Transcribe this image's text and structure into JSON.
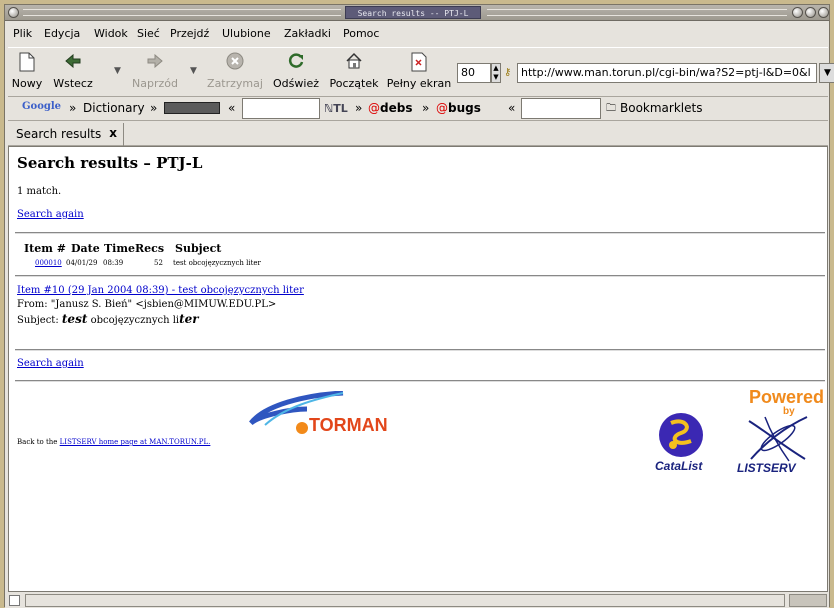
{
  "window": {
    "title": "Search results -- PTJ-L"
  },
  "menu": [
    "Plik",
    "Edycja",
    "Widok",
    "Sieć",
    "Przejdź",
    "Ulubione",
    "Zakładki",
    "Pomoc"
  ],
  "toolbar": {
    "new_label": "Nowy",
    "back_label": "Wstecz",
    "forward_label": "Naprzód",
    "stop_label": "Zatrzymaj",
    "reload_label": "Odśwież",
    "home_label": "Początek",
    "fullscreen_label": "Pełny ekran",
    "zoom_value": "80",
    "url_value": "http://www.man.torun.pl/cgi-bin/wa?S2=ptj-l&D=0&l"
  },
  "bookmarks": {
    "google_label": "Google",
    "dictionary_label": "Dictionary",
    "debs_label": "debs",
    "bugs_label": "bugs",
    "bookmarklets_label": "Bookmarklets",
    "sep": "»",
    "lsep": "«"
  },
  "tabs": [
    {
      "label": "Search results",
      "close": "x"
    }
  ],
  "page": {
    "heading": "Search results – PTJ-L",
    "match_text": "1 match.",
    "search_again": "Search again",
    "columns": [
      "Item #",
      "Date",
      "Time",
      "Recs",
      "Subject"
    ],
    "rows": [
      {
        "item": "000010",
        "date": "04/01/29",
        "time": "08:39",
        "recs": "52",
        "subject": "test obcojęzycznych liter"
      }
    ],
    "item_link": "Item #10 (29 Jan 2004 08:39) - test obcojęzycznych liter",
    "from_text": "From: \"Janusz S. Bień\" <jsbien@MIMUW.EDU.PL>",
    "subject_prefix": "Subject:",
    "subject_bold1": "test",
    "subject_mid": "obcojęzycznych li",
    "subject_bold2": "ter",
    "back_to_prefix": "Back to the",
    "back_to_link": "LISTSERV home page at MAN.TORUN.PL.",
    "torman_logo": "TORMAN",
    "catalist_label": "CataList",
    "powered_label": "Powered",
    "by_label": "by",
    "listserv_label": "LISTSERV"
  },
  "colors": {
    "link": "#0000cc",
    "title_bar": "#5d5b78",
    "torman_orange": "#e2461a",
    "powered_orange": "#f08a1c",
    "logo_navy": "#1a237e"
  }
}
